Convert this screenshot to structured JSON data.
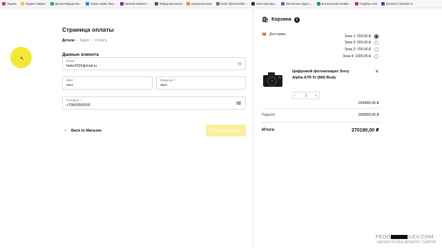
{
  "bookmarks": [
    {
      "label": "Яндекс",
      "color": "#e53935"
    },
    {
      "label": "Яндекс Маркет",
      "color": "#fbc02d"
    },
    {
      "label": "Школа Фёдора Ва...",
      "color": "#43a047"
    },
    {
      "label": "Уроки Adobe Illus...",
      "color": "#1e88e5"
    },
    {
      "label": "Личный кабинет -...",
      "color": "#8e24aa"
    },
    {
      "label": "Фёдор Васильев",
      "color": "#6d4c41"
    },
    {
      "label": "Одноклассники",
      "color": "#fb8c00"
    },
    {
      "label": "fedor (@electrofeb...",
      "color": "#607d8b"
    },
    {
      "label": "store.steampo...",
      "color": "#263238"
    },
    {
      "label": "Магнитные бури с...",
      "color": "#5c6bc0"
    },
    {
      "label": "Бесплатный онлайн...",
      "color": "#009688"
    },
    {
      "label": "Подбор слов",
      "color": "#e91e63"
    },
    {
      "label": "IDmetrix | Website S...",
      "color": "#3949ab"
    }
  ],
  "checkout": {
    "title": "Страница оплаты",
    "breadcrumbs": [
      "Детали",
      "Адрес",
      "Оплата"
    ],
    "section_title": "Данные клиента",
    "email": {
      "label": "Email *",
      "value": "fedor2626@mail.ru"
    },
    "first_name": {
      "label": "Имя *",
      "value": "тест"
    },
    "last_name": {
      "label": "Фамилия *",
      "value": "тест"
    },
    "phone": {
      "label": "Телефон *",
      "value": "+79600000000"
    },
    "back_label": "Back to Магазин",
    "submit_label": "Сохранить на адрес"
  },
  "cart": {
    "title": "Корзина",
    "count": "1",
    "delivery_label": "Доставка",
    "zones": [
      {
        "label": "Зона 1: 200,00 ₽",
        "selected": true
      },
      {
        "label": "Зона 2: 500,00 ₽",
        "selected": false
      },
      {
        "label": "Зона 2: 700,00 ₽",
        "selected": false
      },
      {
        "label": "Зона 4: 1000,00 ₽",
        "selected": false
      }
    ],
    "product": {
      "name": "Цифровой фотоаппарат Sony Alpha A7R IV (M4) Body",
      "qty": "1",
      "price": "269990,00 ₽"
    },
    "subtotal_label": "Подытог",
    "subtotal_value": "269990,00 ₽",
    "total_label": "Итого",
    "total_value": "270190,00 ₽"
  },
  "watermark": {
    "line1_start": "FEDO",
    "line1_end": "ILEV.COM",
    "line2": "ШКОЛА ПО ВЕБ-ДИЗАЙНУ САЙТОВ"
  },
  "colors": {
    "accent": "#f3e72a",
    "submit_bg": "#fbf09a"
  }
}
